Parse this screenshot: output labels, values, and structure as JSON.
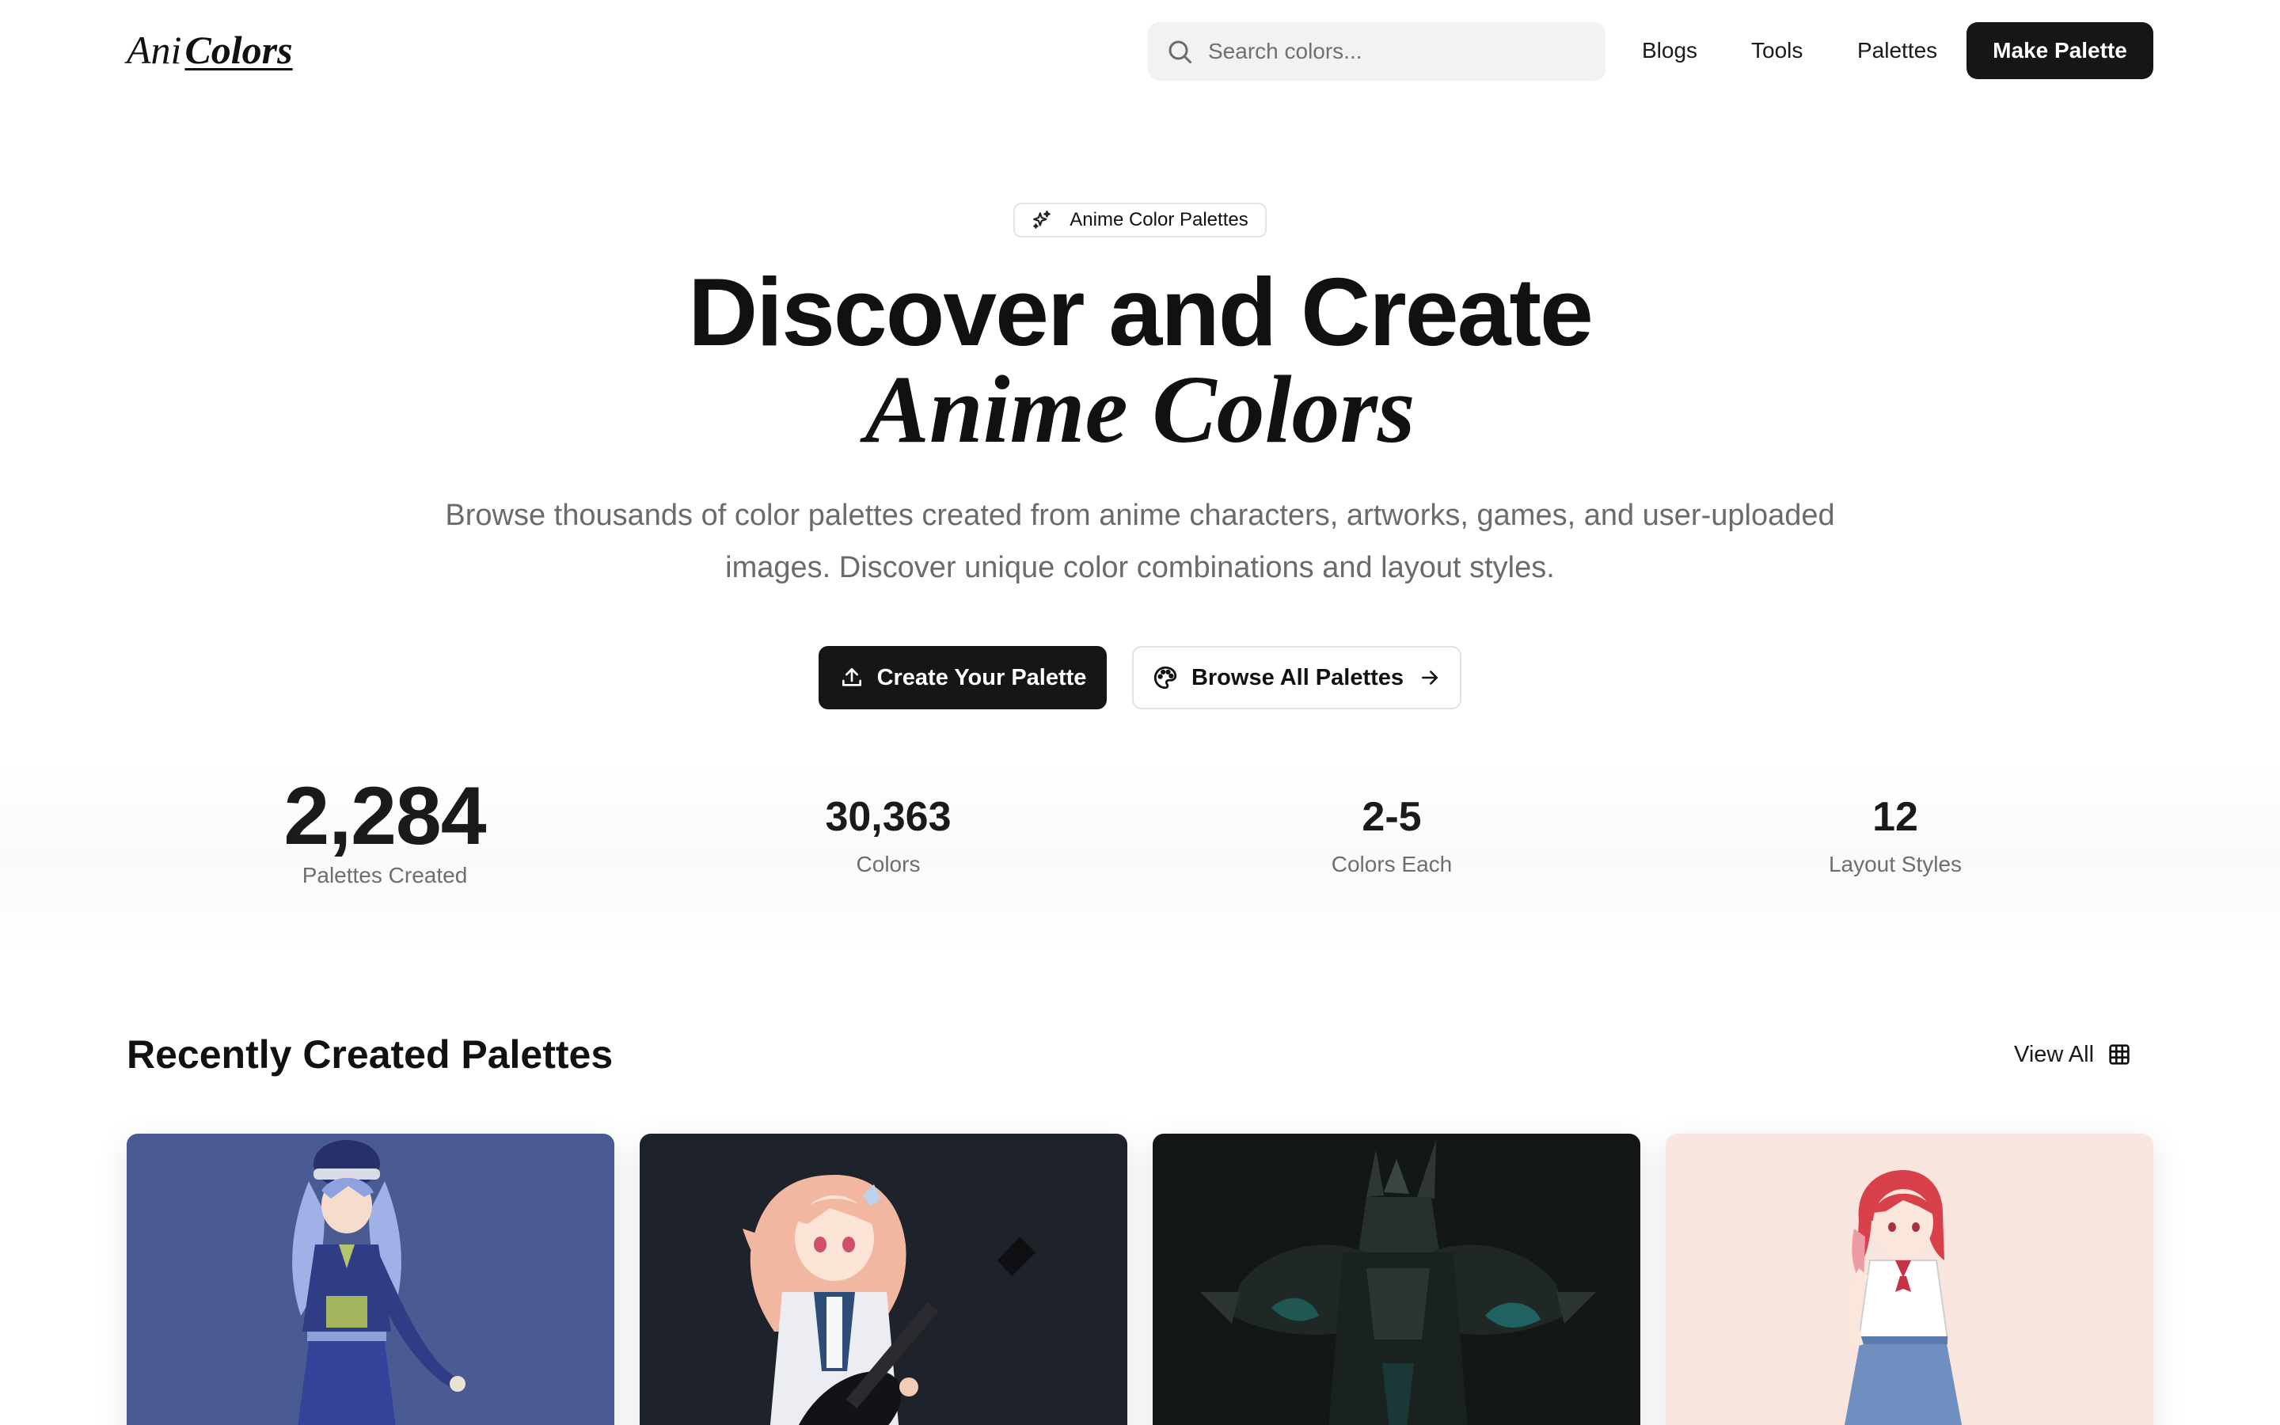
{
  "header": {
    "logo_part1": "Ani",
    "logo_part2": "Colors",
    "search_placeholder": "Search colors...",
    "nav": [
      {
        "label": "Blogs"
      },
      {
        "label": "Tools"
      },
      {
        "label": "Palettes"
      }
    ],
    "cta_label": "Make Palette"
  },
  "hero": {
    "badge": "Anime Color Palettes",
    "title_line1": "Discover and Create",
    "title_line2": "Anime Colors",
    "subtitle": "Browse thousands of color palettes created from anime characters, artworks, games, and user-uploaded images. Discover unique color combinations and layout styles.",
    "primary_button": "Create Your Palette",
    "secondary_button": "Browse All Palettes"
  },
  "stats": [
    {
      "value": "2,284",
      "label": "Palettes Created"
    },
    {
      "value": "30,363",
      "label": "Colors"
    },
    {
      "value": "2-5",
      "label": "Colors Each"
    },
    {
      "value": "12",
      "label": "Layout Styles"
    }
  ],
  "recent": {
    "title": "Recently Created Palettes",
    "view_all": "View All",
    "cards": [
      {
        "background": "#4a5a92",
        "icon": "anime-character-image"
      },
      {
        "background": "#1e222a",
        "icon": "anime-character-image"
      },
      {
        "background": "#131816",
        "icon": "armored-character-image"
      },
      {
        "background": "#f7e5de",
        "icon": "anime-character-image"
      }
    ]
  },
  "colors": {
    "accent_dark": "#161616",
    "muted_text": "#6b6b6b",
    "search_bg": "#f2f2f2"
  }
}
